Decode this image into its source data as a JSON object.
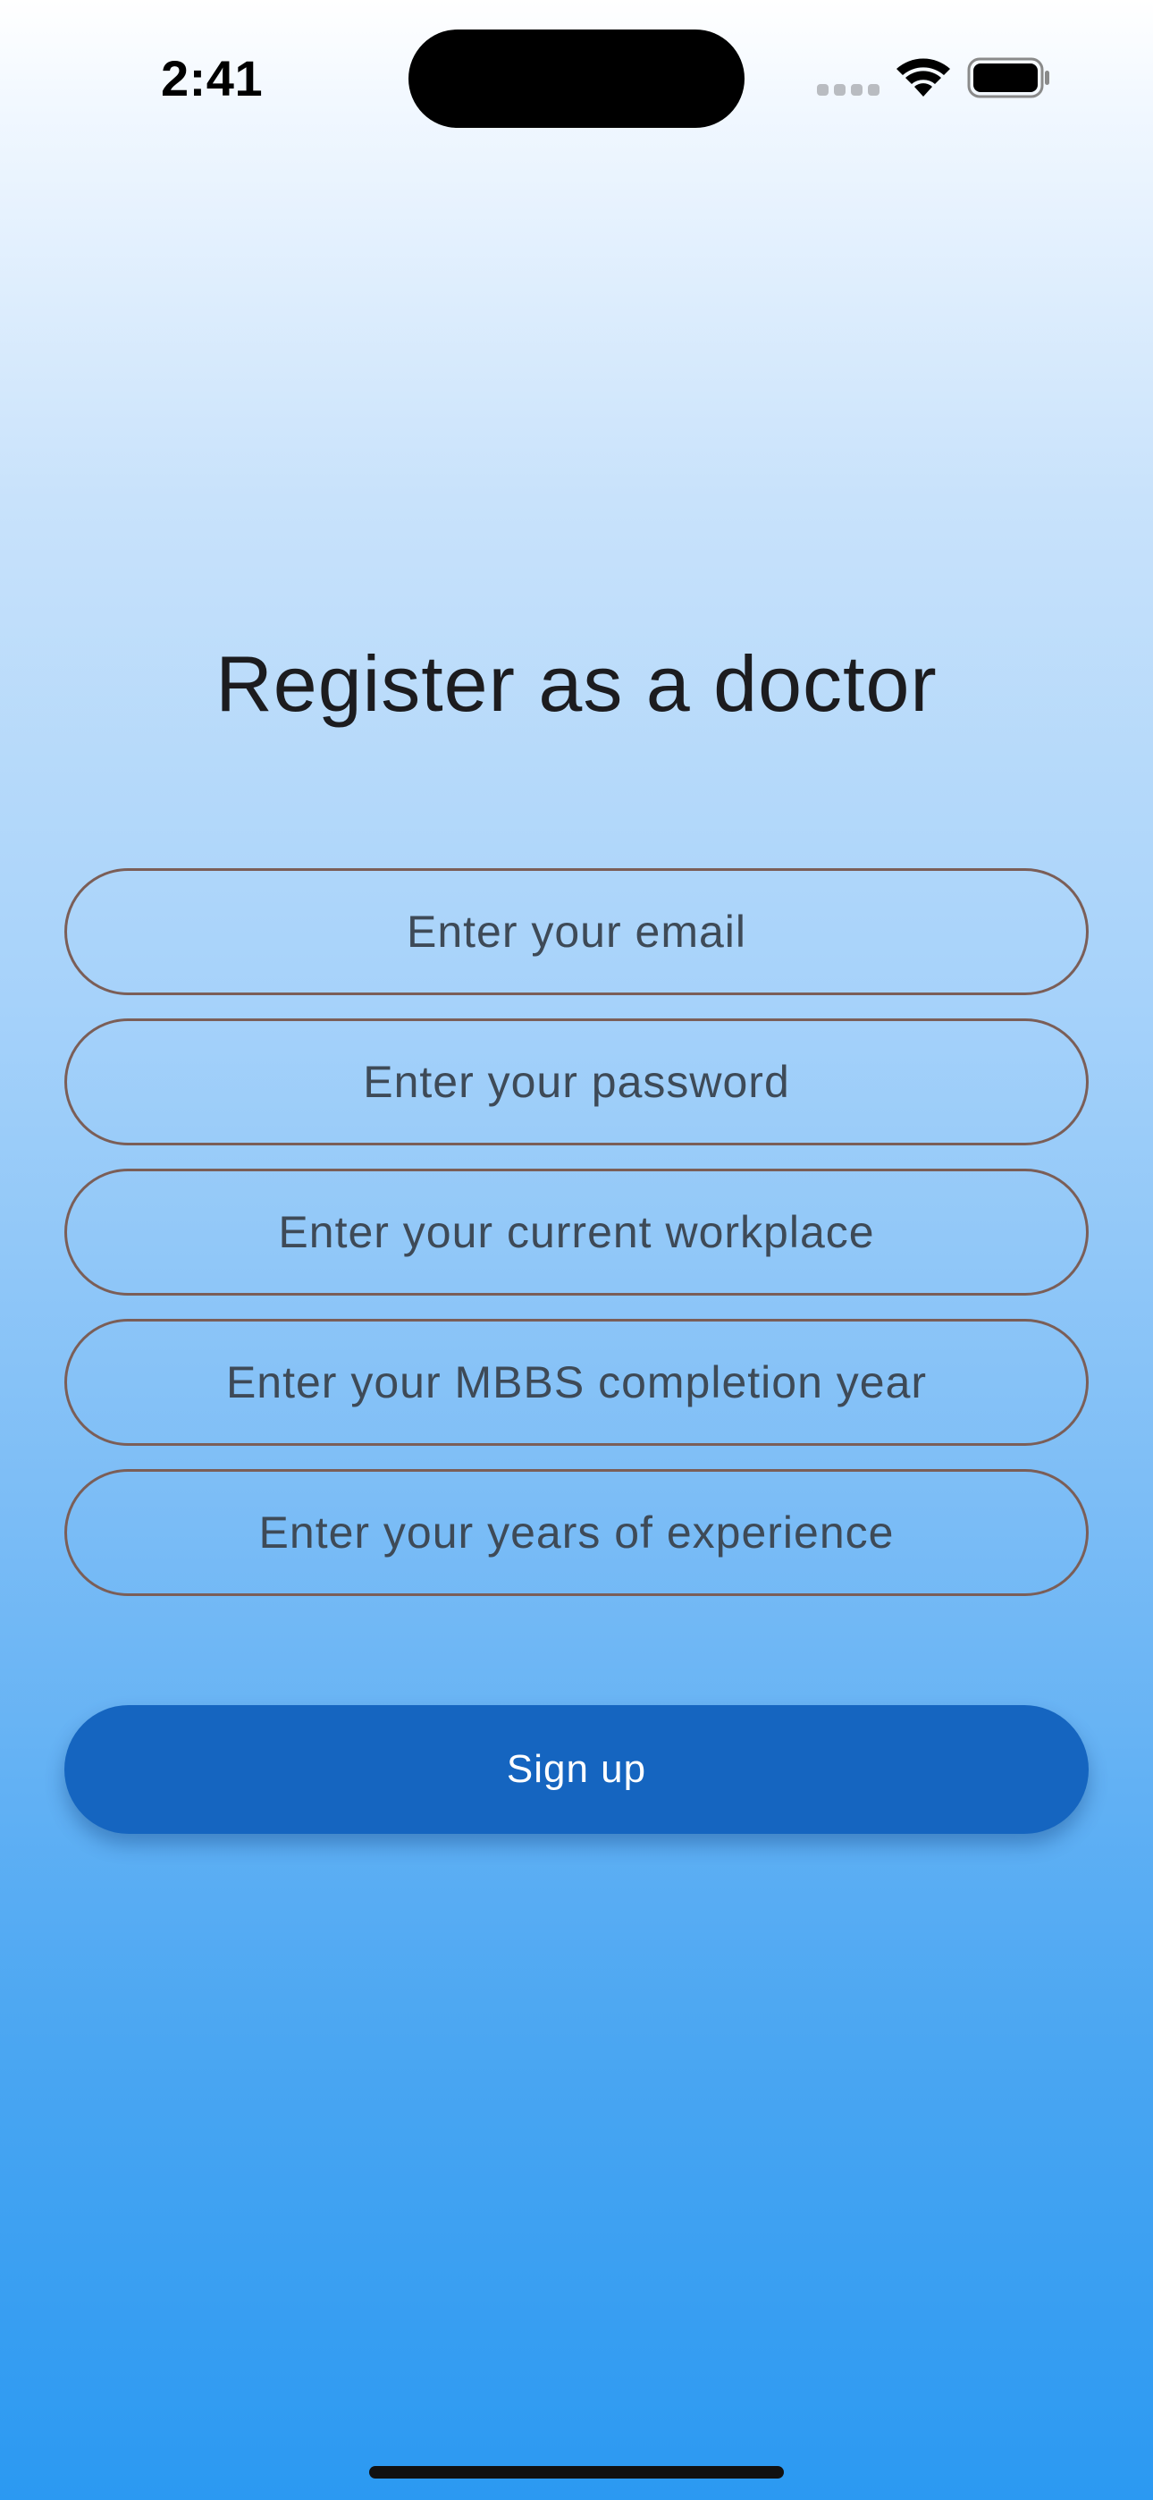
{
  "status_bar": {
    "time": "2:41",
    "icons": [
      "cellular-signal-icon",
      "wifi-icon",
      "battery-icon"
    ]
  },
  "page": {
    "title": "Register as a doctor"
  },
  "form": {
    "email_placeholder": "Enter your email",
    "password_placeholder": "Enter your password",
    "workplace_placeholder": "Enter your current workplace",
    "mbbs_year_placeholder": "Enter your MBBS completion year",
    "experience_placeholder": "Enter your years of experience",
    "submit_label": "Sign up"
  },
  "colors": {
    "button": "#1565c0",
    "field_border": "#7b5e57",
    "gradient_top": "#ffffff",
    "gradient_bottom": "#2b99f2"
  }
}
